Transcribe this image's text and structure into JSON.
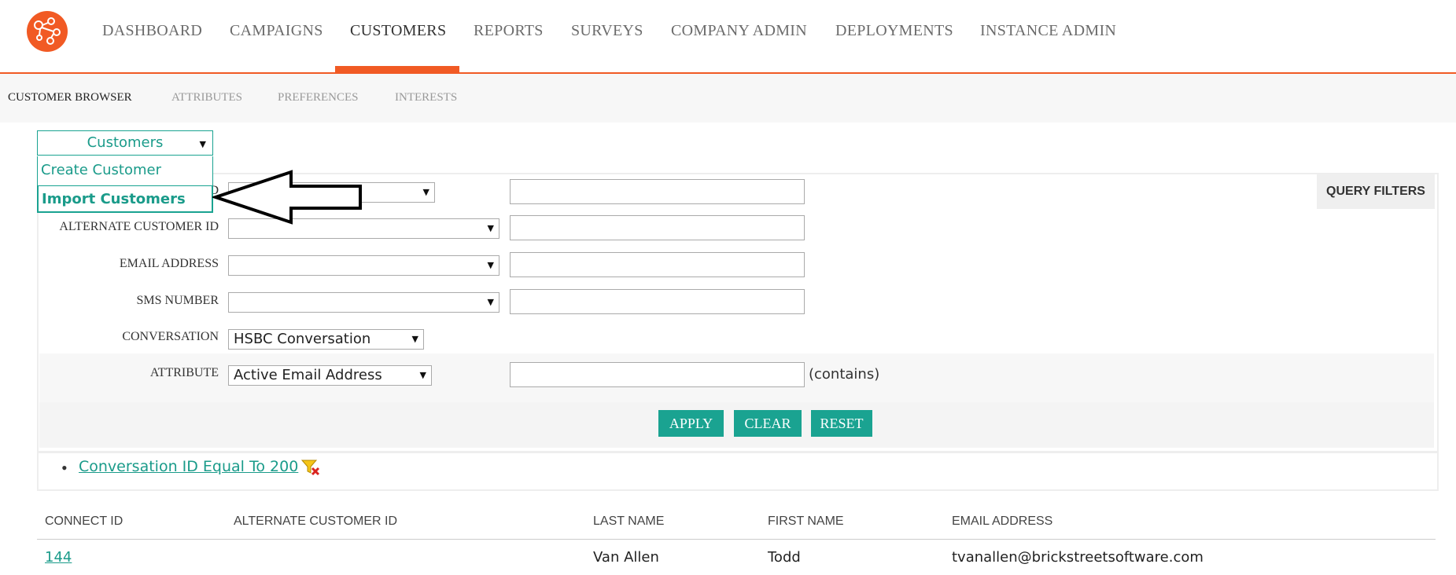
{
  "nav": {
    "items": [
      {
        "label": "DASHBOARD"
      },
      {
        "label": "CAMPAIGNS"
      },
      {
        "label": "CUSTOMERS"
      },
      {
        "label": "REPORTS"
      },
      {
        "label": "SURVEYS"
      },
      {
        "label": "COMPANY ADMIN"
      },
      {
        "label": "DEPLOYMENTS"
      },
      {
        "label": "INSTANCE ADMIN"
      }
    ],
    "active": "CUSTOMERS",
    "accent_color": "#f15a24"
  },
  "subnav": {
    "items": [
      {
        "label": "CUSTOMER BROWSER"
      },
      {
        "label": "ATTRIBUTES"
      },
      {
        "label": "PREFERENCES"
      },
      {
        "label": "INTERESTS"
      }
    ],
    "active": "CUSTOMER BROWSER"
  },
  "dropdown": {
    "selected": "Customers",
    "items": [
      {
        "label": "Create Customer"
      },
      {
        "label": "Import Customers"
      }
    ],
    "highlighted": "Import Customers",
    "accent_color": "#1aa391"
  },
  "query_filters_tab": "QUERY FILTERS",
  "filters": [
    {
      "label": "D",
      "operator": "",
      "value": ""
    },
    {
      "label": "ALTERNATE CUSTOMER ID",
      "operator": "",
      "value": ""
    },
    {
      "label": "EMAIL ADDRESS",
      "operator": "",
      "value": ""
    },
    {
      "label": "SMS NUMBER",
      "operator": "",
      "value": ""
    },
    {
      "label": "CONVERSATION",
      "operator": "HSBC Conversation"
    },
    {
      "label": "ATTRIBUTE",
      "operator": "Active Email Address",
      "value": "",
      "suffix": "(contains)"
    }
  ],
  "buttons": {
    "apply": "APPLY",
    "clear": "CLEAR",
    "reset": "RESET"
  },
  "applied_filters": [
    {
      "text": "Conversation ID Equal To 200",
      "icon": "filter-remove-icon"
    }
  ],
  "table": {
    "columns": [
      "CONNECT ID",
      "ALTERNATE CUSTOMER ID",
      "LAST NAME",
      "FIRST NAME",
      "EMAIL ADDRESS"
    ],
    "rows": [
      {
        "connect_id": "144",
        "alternate_id": "",
        "last_name": "Van Allen",
        "first_name": "Todd",
        "email": "tvanallen@brickstreetsoftware.com"
      }
    ]
  }
}
